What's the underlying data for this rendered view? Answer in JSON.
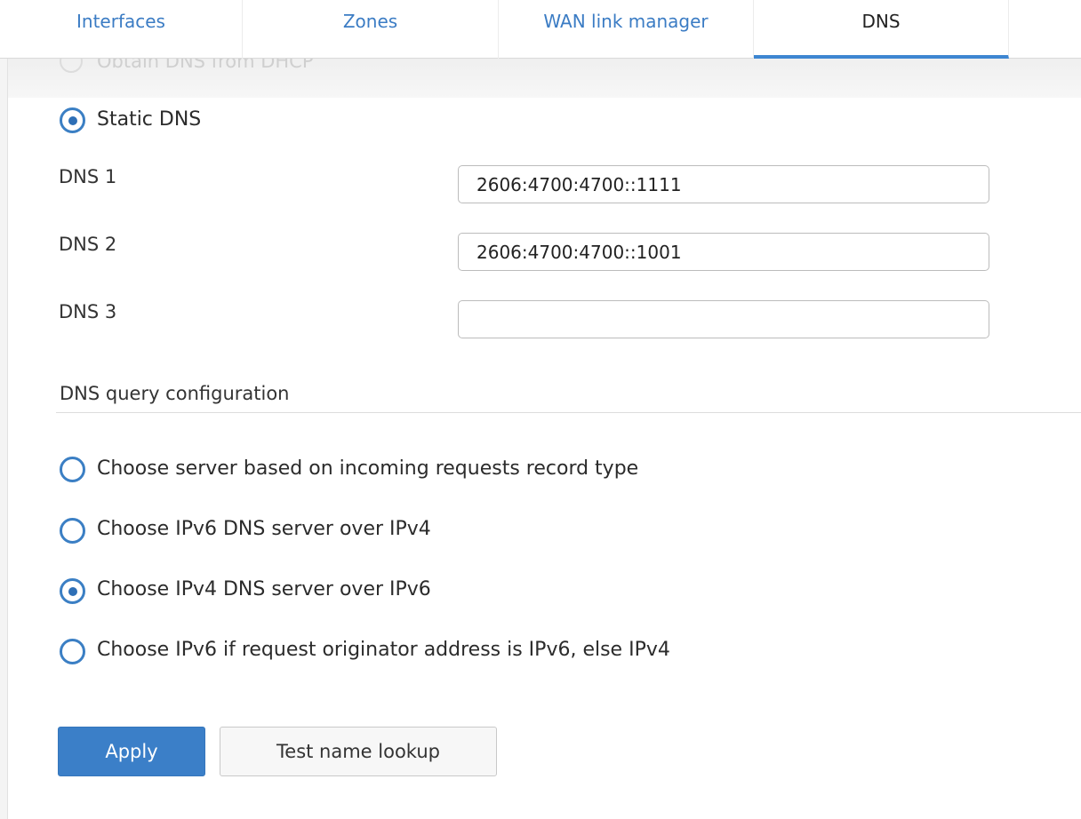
{
  "tabs": [
    {
      "label": "Interfaces",
      "active": false
    },
    {
      "label": "Zones",
      "active": false
    },
    {
      "label": "WAN link manager",
      "active": false
    },
    {
      "label": "DNS",
      "active": true
    }
  ],
  "dns_source": {
    "dhcp_label": "Obtain DNS from DHCP",
    "static_label": "Static DNS",
    "selected": "static"
  },
  "dns_servers": [
    {
      "label": "DNS 1",
      "value": "2606:4700:4700::1111"
    },
    {
      "label": "DNS 2",
      "value": "2606:4700:4700::1001"
    },
    {
      "label": "DNS 3",
      "value": ""
    }
  ],
  "query_config": {
    "title": "DNS query configuration",
    "options": [
      {
        "label": "Choose server based on incoming requests record type",
        "checked": false
      },
      {
        "label": "Choose IPv6 DNS server over IPv4",
        "checked": false
      },
      {
        "label": "Choose IPv4 DNS server over IPv6",
        "checked": true
      },
      {
        "label": "Choose IPv6 if request originator address is IPv6, else IPv4",
        "checked": false
      }
    ]
  },
  "actions": {
    "apply_label": "Apply",
    "test_label": "Test name lookup"
  },
  "colors": {
    "accent": "#3b7fc8",
    "tab_link": "#3b7cc4"
  }
}
